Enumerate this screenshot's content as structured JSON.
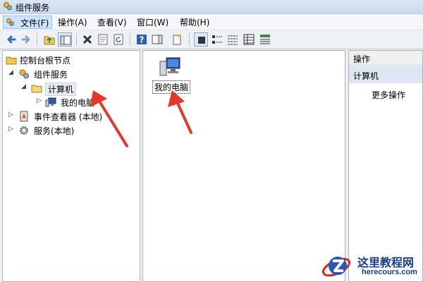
{
  "window": {
    "title": "组件服务"
  },
  "menu": [
    {
      "label": "文件(F)",
      "name": "menu-file"
    },
    {
      "label": "操作(A)",
      "name": "menu-action"
    },
    {
      "label": "查看(V)",
      "name": "menu-view"
    },
    {
      "label": "窗口(W)",
      "name": "menu-window"
    },
    {
      "label": "帮助(H)",
      "name": "menu-help"
    }
  ],
  "toolbar": [
    "back-arrow-icon",
    "forward-arrow-icon",
    "up-folder-icon",
    "show-hide-tree-icon",
    "delete-icon",
    "properties-icon",
    "refresh-icon",
    "help-icon",
    "show-hide-action-pane-icon",
    "new-item-icon",
    "large-icons-view-icon",
    "small-icons-view-icon",
    "list-view-icon",
    "details-view-icon",
    "status-view-icon"
  ],
  "tree": {
    "root": "控制台根节点",
    "component_services": "组件服务",
    "computers": "计算机",
    "my_computer": "我的电脑",
    "event_viewer": "事件查看器 (本地)",
    "services": "服务(本地)"
  },
  "content": {
    "item_label": "我的电脑"
  },
  "actions": {
    "header": "操作",
    "section": "计算机",
    "more": "更多操作"
  },
  "watermark": {
    "title": "这里教程网",
    "url": "herecours.com"
  },
  "colors": {
    "arrow": "#e8362a",
    "selection": "#cfe3fb",
    "brand": "#1b3c8c"
  }
}
